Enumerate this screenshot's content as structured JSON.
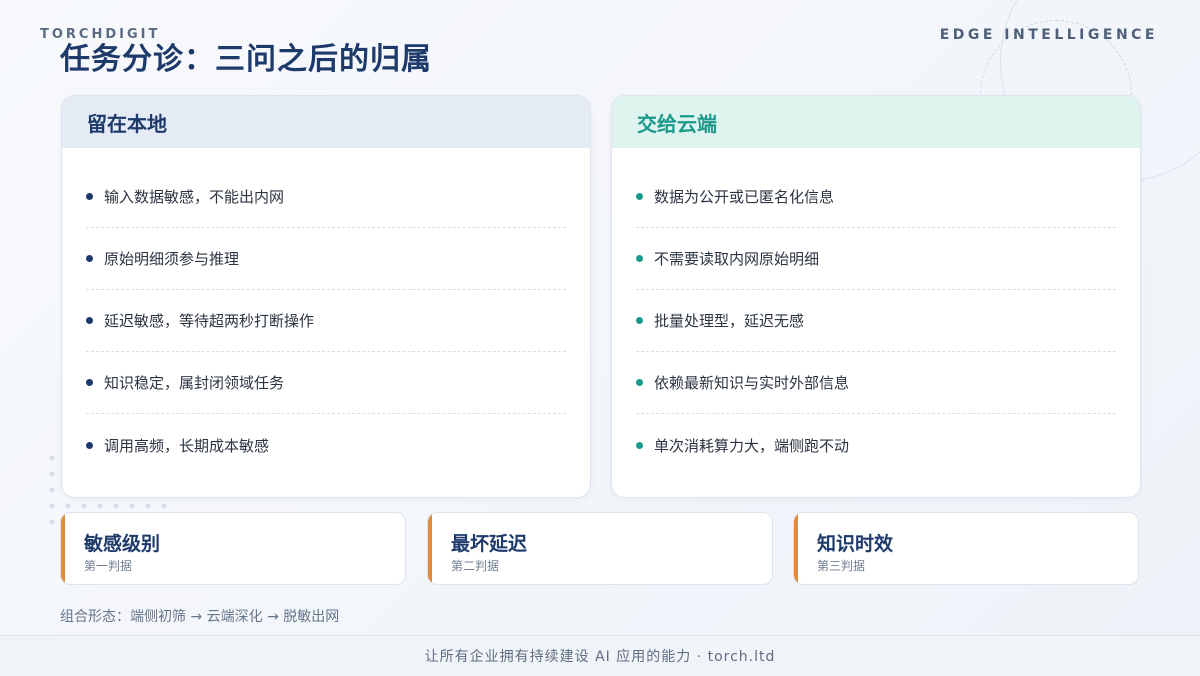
{
  "header": {
    "brand_left": "TORCHDIGIT",
    "brand_right": "EDGE INTELLIGENCE",
    "title": "任务分诊：三问之后的归属"
  },
  "colors": {
    "navy": "#1d3a6b",
    "teal": "#1b9a8c",
    "orange_accent": "#e08a3a"
  },
  "left_panel": {
    "heading": "留在本地",
    "items": [
      "输入数据敏感，不能出内网",
      "原始明细须参与推理",
      "延迟敏感，等待超两秒打断操作",
      "知识稳定，属封闭领域任务",
      "调用高频，长期成本敏感"
    ]
  },
  "right_panel": {
    "heading": "交给云端",
    "items": [
      "数据为公开或已匿名化信息",
      "不需要读取内网原始明细",
      "批量处理型，延迟无感",
      "依赖最新知识与实时外部信息",
      "单次消耗算力大，端侧跑不动"
    ]
  },
  "criteria": [
    {
      "title": "敏感级别",
      "sub": "第一判据"
    },
    {
      "title": "最坏延迟",
      "sub": "第二判据"
    },
    {
      "title": "知识时效",
      "sub": "第三判据"
    }
  ],
  "combo_text": "组合形态：端侧初筛 → 云端深化 → 脱敏出网",
  "footer_text": "让所有企业拥有持续建设 AI 应用的能力 · torch.ltd"
}
